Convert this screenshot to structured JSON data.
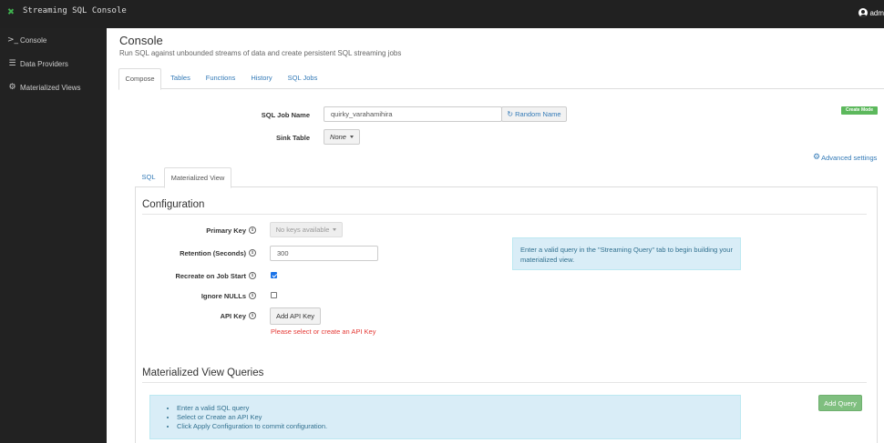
{
  "app": {
    "title": "Streaming SQL Console",
    "user": "adm"
  },
  "sidebar": {
    "items": [
      {
        "label": "Console",
        "icon": "terminal-icon"
      },
      {
        "label": "Data Providers",
        "icon": "list-icon"
      },
      {
        "label": "Materialized Views",
        "icon": "gear-icon"
      }
    ]
  },
  "page": {
    "title": "Console",
    "subtitle": "Run SQL against unbounded streams of data and create persistent SQL streaming jobs"
  },
  "tabs": [
    {
      "label": "Compose",
      "active": true
    },
    {
      "label": "Tables",
      "active": false
    },
    {
      "label": "Functions",
      "active": false
    },
    {
      "label": "History",
      "active": false
    },
    {
      "label": "SQL Jobs",
      "active": false
    }
  ],
  "compose": {
    "job_name_label": "SQL Job Name",
    "job_name_value": "quirky_varahamihira",
    "random_name_button": "Random Name",
    "sink_table_label": "Sink Table",
    "sink_table_value": "None",
    "mode_badge": "Create Mode",
    "advanced_settings": "Advanced settings"
  },
  "subtabs": [
    {
      "label": "SQL",
      "active": false
    },
    {
      "label": "Materialized View",
      "active": true
    }
  ],
  "configuration": {
    "title": "Configuration",
    "primary_key_label": "Primary Key",
    "primary_key_value": "No keys available",
    "retention_label": "Retention (Seconds)",
    "retention_value": "300",
    "recreate_label": "Recreate on Job Start",
    "recreate_checked": true,
    "ignore_nulls_label": "Ignore NULLs",
    "ignore_nulls_checked": false,
    "api_key_label": "API Key",
    "add_api_key_button": "Add API Key",
    "api_key_error": "Please select or create an API Key",
    "info_message": "Enter a valid query in the \"Streaming Query\" tab to begin building your materialized view."
  },
  "mv_queries": {
    "title": "Materialized View Queries",
    "instructions": [
      "Enter a valid SQL query",
      "Select or Create an API Key",
      "Click Apply Configuration to commit configuration."
    ],
    "add_query_button": "Add Query"
  },
  "colors": {
    "topbar": "#212121",
    "sidebar": "#222222",
    "link": "#337ab7",
    "success": "#5cb85c",
    "error": "#e53935",
    "info_bg": "#d9edf7"
  }
}
